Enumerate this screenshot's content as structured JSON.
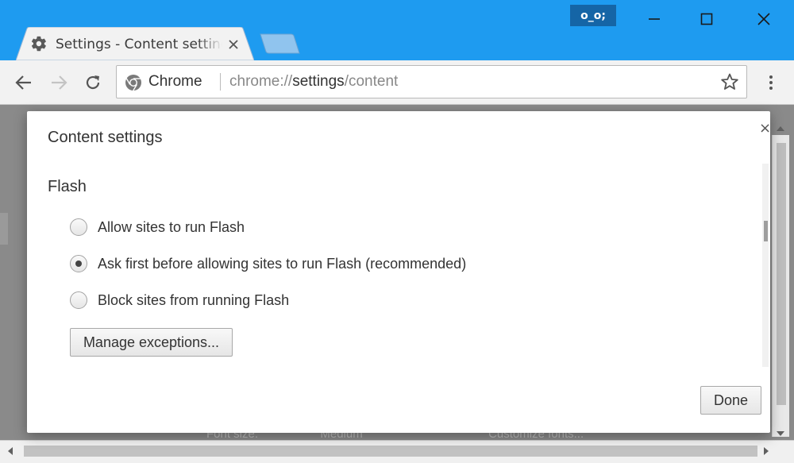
{
  "window": {
    "profile_badge": "o_o;",
    "controls": [
      "minimize-icon",
      "maximize-icon",
      "close-icon"
    ]
  },
  "tab": {
    "title": "Settings - Content settings",
    "icon": "gear-icon"
  },
  "toolbar": {
    "omnibox_chip": "Chrome",
    "url_scheme": "chrome://",
    "url_host": "settings",
    "url_path": "/content"
  },
  "page_background": {
    "font_size_label": "Font size:",
    "font_size_value": "Medium",
    "customize_fonts": "Customize fonts..."
  },
  "dialog": {
    "title": "Content settings",
    "close_symbol": "×",
    "section_title": "Flash",
    "options": [
      {
        "label": "Allow sites to run Flash",
        "checked": false
      },
      {
        "label": "Ask first before allowing sites to run Flash (recommended)",
        "checked": true
      },
      {
        "label": "Block sites from running Flash",
        "checked": false
      }
    ],
    "manage_button": "Manage exceptions...",
    "done_button": "Done"
  },
  "colors": {
    "titlebar": "#1e9bf0",
    "toolbar": "#f2f2f2",
    "page_overlay": "#8a8a8a"
  }
}
